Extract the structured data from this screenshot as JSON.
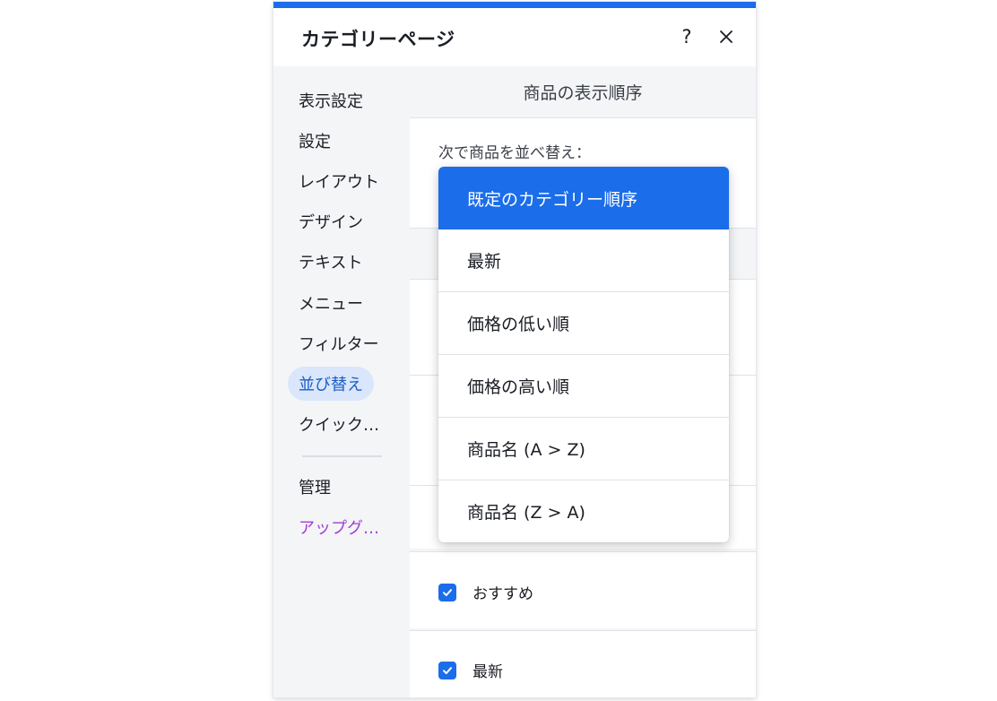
{
  "panel": {
    "title": "カテゴリーページ",
    "help_label": "?",
    "close_icon": "close-icon"
  },
  "sidebar": {
    "items": [
      {
        "label": "表示設定"
      },
      {
        "label": "設定"
      },
      {
        "label": "レイアウト"
      },
      {
        "label": "デザイン"
      },
      {
        "label": "テキスト"
      },
      {
        "label": "メニュー"
      },
      {
        "label": "フィルター"
      },
      {
        "label": "並び替え",
        "active": true
      },
      {
        "label": "クイック…"
      }
    ],
    "bottom_items": [
      {
        "label": "管理"
      },
      {
        "label": "アップグ…"
      }
    ]
  },
  "content": {
    "section_title": "商品の表示順序",
    "sort_by_label": "次で商品を並べ替え：",
    "options": [
      {
        "label": "おすすめ",
        "checked": true
      },
      {
        "label": "最新",
        "checked": true
      }
    ]
  },
  "dropdown": {
    "items": [
      {
        "label": "既定のカテゴリー順序",
        "selected": true
      },
      {
        "label": "最新"
      },
      {
        "label": "価格の低い順"
      },
      {
        "label": "価格の高い順"
      },
      {
        "label": "商品名 (A > Z)"
      },
      {
        "label": "商品名 (Z > A)"
      }
    ]
  },
  "colors": {
    "accent": "#1b6de9",
    "active_nav_bg": "#d9e6fb",
    "active_nav_text": "#1b5fc6",
    "upgrade_text": "#a43cd6",
    "sidebar_bg": "#f4f5f7"
  }
}
